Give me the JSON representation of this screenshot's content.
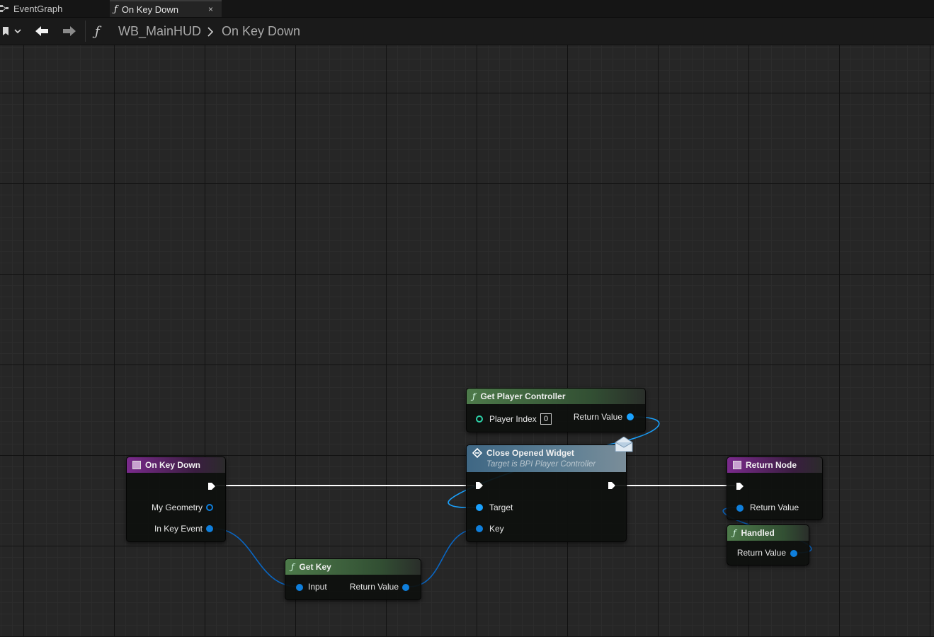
{
  "tabs": [
    {
      "label": "EventGraph",
      "icon": "graph-icon"
    },
    {
      "label": "On Key Down",
      "icon": "function-icon",
      "close": "×"
    }
  ],
  "breadcrumb": {
    "function_glyph": "ƒ",
    "path": [
      "WB_MainHUD",
      "On Key Down"
    ]
  },
  "nodes": {
    "on_key_down": {
      "title": "On Key Down",
      "pins": {
        "geometry": "My Geometry",
        "key_event": "In Key Event"
      }
    },
    "get_key": {
      "title": "Get Key",
      "pins": {
        "input": "Input",
        "return": "Return Value"
      }
    },
    "get_player_controller": {
      "title": "Get Player Controller",
      "pins": {
        "player_index": "Player Index",
        "player_index_value": "0",
        "return": "Return Value"
      }
    },
    "close_opened_widget": {
      "title": "Close Opened Widget",
      "subtitle": "Target is BPI Player Controller",
      "pins": {
        "target": "Target",
        "key": "Key"
      }
    },
    "return_node": {
      "title": "Return Node",
      "pins": {
        "return": "Return Value"
      }
    },
    "handled": {
      "title": "Handled",
      "pins": {
        "return": "Return Value"
      }
    }
  },
  "colors": {
    "event_header": "#7a2a8c",
    "pure_function_header": "#4d7a4a",
    "message_header": "#3f6784",
    "struct_pin": "#0f7fdc",
    "object_pin": "#1aa2ff",
    "int_pin": "#2dd2a8",
    "exec_wire": "#ffffff"
  }
}
